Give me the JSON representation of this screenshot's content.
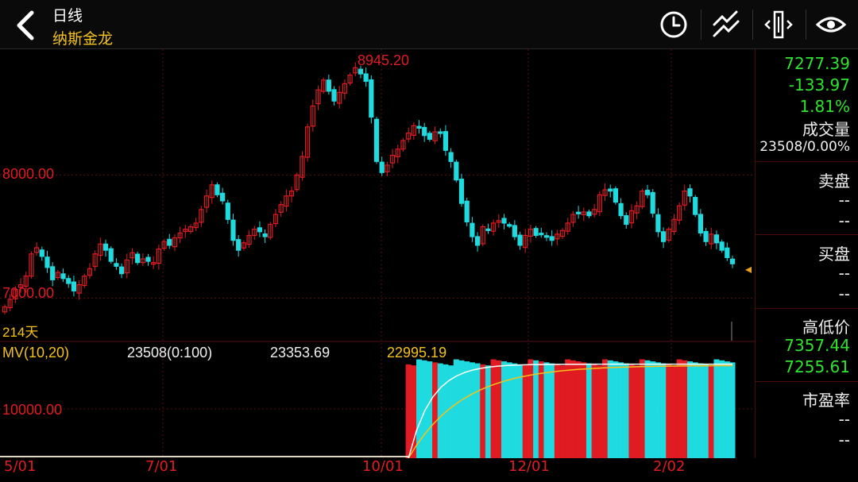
{
  "header": {
    "title": "日线",
    "subtitle": "纳斯金龙",
    "icons": [
      "back-icon",
      "clock-icon",
      "draw-lines-icon",
      "adjust-width-icon",
      "eye-icon"
    ]
  },
  "colors": {
    "up": "#e11b22",
    "down": "#1fdbe0",
    "accent": "#f4c21b",
    "green": "#2fe32f",
    "grid": "#5a1010"
  },
  "price_panel": {
    "high_label": "8945.20",
    "y_labels": [
      "8000.00",
      "7000.00"
    ],
    "days_label": "214天",
    "marker": "◂"
  },
  "volume_panel": {
    "indicator_label": "MV(10,20)",
    "vol_value": "23508(0:100)",
    "mv10": "23353.69",
    "mv20": "22995.19",
    "y_label": "10000.00"
  },
  "x_axis": [
    "5/01",
    "7/01",
    "10/01",
    "12/01",
    "2/02"
  ],
  "sidebar": {
    "price": "7277.39",
    "change": "-133.97",
    "change_pct": "1.81%",
    "volume_label": "成交量",
    "volume_value": "23508/0.00%",
    "sell_label": "卖盘",
    "sell_1": "--",
    "sell_2": "--",
    "buy_label": "买盘",
    "buy_1": "--",
    "buy_2": "--",
    "highlow_label": "高低价",
    "high": "7357.44",
    "low": "7255.61",
    "pe_label": "市盈率",
    "pe_1": "--",
    "pe_2": "--"
  },
  "chart_data": {
    "type": "candlestick",
    "x_ticks": [
      "5/01",
      "7/01",
      "10/01",
      "12/01",
      "2/02"
    ],
    "ylim": [
      6650,
      9020
    ],
    "y_ticks": [
      8000,
      7000
    ],
    "max_label": 8945.2,
    "close_series": [
      6930,
      6990,
      7070,
      7110,
      7180,
      7360,
      7410,
      7340,
      7250,
      7150,
      7210,
      7160,
      7120,
      7060,
      7110,
      7180,
      7240,
      7360,
      7440,
      7390,
      7300,
      7260,
      7200,
      7310,
      7370,
      7290,
      7320,
      7300,
      7290,
      7400,
      7460,
      7430,
      7490,
      7530,
      7560,
      7580,
      7610,
      7720,
      7830,
      7920,
      7840,
      7790,
      7640,
      7470,
      7390,
      7450,
      7510,
      7560,
      7540,
      7500,
      7600,
      7680,
      7760,
      7830,
      7870,
      8000,
      8150,
      8390,
      8560,
      8690,
      8770,
      8680,
      8600,
      8670,
      8740,
      8810,
      8870,
      8820,
      8760,
      8470,
      8110,
      8020,
      8080,
      8160,
      8210,
      8280,
      8340,
      8400,
      8380,
      8320,
      8290,
      8350,
      8340,
      8200,
      8110,
      7960,
      7770,
      7620,
      7500,
      7430,
      7580,
      7550,
      7610,
      7630,
      7610,
      7590,
      7500,
      7430,
      7510,
      7560,
      7510,
      7520,
      7500,
      7470,
      7520,
      7550,
      7610,
      7680,
      7690,
      7700,
      7670,
      7720,
      7840,
      7880,
      7870,
      7780,
      7670,
      7600,
      7710,
      7750,
      7870,
      7840,
      7690,
      7540,
      7460,
      7560,
      7640,
      7750,
      7870,
      7830,
      7680,
      7530,
      7460,
      7520,
      7450,
      7390,
      7330,
      7280
    ],
    "volume_ylim": [
      0,
      25000
    ],
    "volume_start_index": 76,
    "volume_values_note_free": true
  }
}
